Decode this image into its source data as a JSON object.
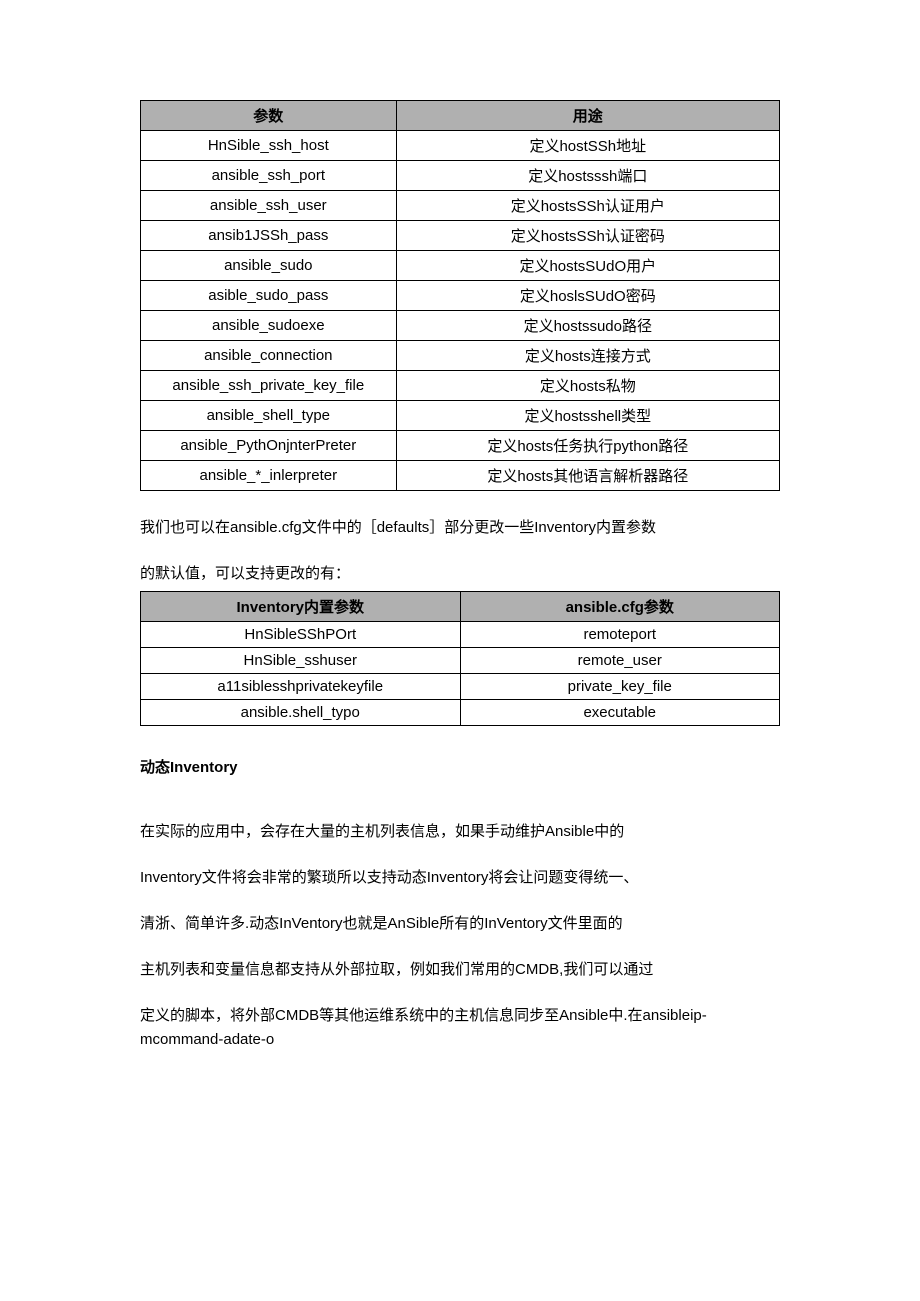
{
  "table1": {
    "headers": [
      "参数",
      "用途"
    ],
    "rows": [
      [
        "HnSible_ssh_host",
        "定义hostSSh地址"
      ],
      [
        "ansible_ssh_port",
        "定义hostsssh端口"
      ],
      [
        "ansible_ssh_user",
        "定义hostsSSh认证用户"
      ],
      [
        "ansib1JSSh_pass",
        "定义hostsSSh认证密码"
      ],
      [
        "ansible_sudo",
        "定义hostsSUdO用户"
      ],
      [
        "asible_sudo_pass",
        "定义hoslsSUdO密码"
      ],
      [
        "ansible_sudoexe",
        "定义hostssudo路径"
      ],
      [
        "ansible_connection",
        "定义hosts连接方式"
      ],
      [
        "ansible_ssh_private_key_file",
        "定义hosts私物"
      ],
      [
        "ansible_shell_type",
        "定义hostsshell类型"
      ],
      [
        "ansible_PythOnjnterPreter",
        "定义hosts任务执行python路径"
      ],
      [
        "ansible_*_inlerpreter",
        "定义hosts其他语言解析器路径"
      ]
    ]
  },
  "para1": "我们也可以在ansible.cfg文件中的［defaults］部分更改一些Inventory内置参数",
  "para2": "的默认值，可以支持更改的有：",
  "table2": {
    "headers": [
      "Inventory内置参数",
      "ansible.cfg参数"
    ],
    "rows": [
      [
        "HnSibleSShPOrt",
        "remoteport"
      ],
      [
        "HnSible_sshuser",
        "remote_user"
      ],
      [
        "a11siblesshprivatekeyfile",
        "private_key_file"
      ],
      [
        "ansible.shell_typo",
        "executable"
      ]
    ]
  },
  "heading": "动态Inventory",
  "para3": "在实际的应用中，会存在大量的主机列表信息，如果手动维护Ansible中的",
  "para4": "Inventory文件将会非常的繁琐所以支持动态Inventory将会让问题变得统一、",
  "para5": "清浙、简单许多.动态InVentory也就是AnSible所有的InVentory文件里面的",
  "para6": "主机列表和变量信息都支持从外部拉取，例如我们常用的CMDB,我们可以通过",
  "para7": "定义的脚本，将外部CMDB等其他运维系统中的主机信息同步至Ansible中.在ansibleip-mcommand-adate-o"
}
